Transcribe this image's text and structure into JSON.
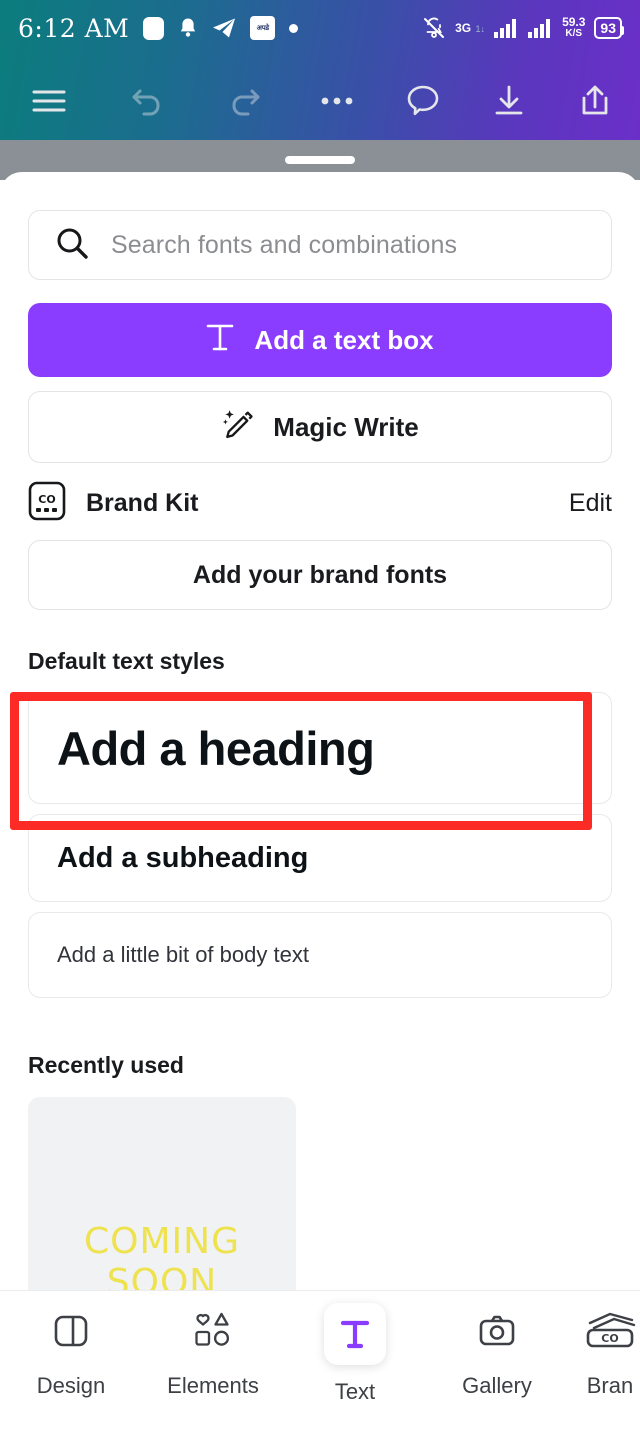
{
  "status_bar": {
    "time": "6:12 AM",
    "left_icons": [
      "rounded-square-icon",
      "bell-icon",
      "telegram-icon",
      "app-badge-icon",
      "dot-icon"
    ],
    "app_badge_text": "अपडे",
    "network_type": "3G",
    "network_sub": "1↓",
    "net_speed_value": "59.3",
    "net_speed_unit": "K/S",
    "battery_level": "93",
    "right_icons": [
      "bell-muted-icon",
      "signal-bars-icon",
      "signal-bars-2-icon",
      "battery-icon"
    ]
  },
  "toolbar": {
    "menu_icon": "hamburger-menu-icon",
    "undo_icon": "undo-icon",
    "redo_icon": "redo-icon",
    "more_icon": "more-dots-icon",
    "comment_icon": "comment-bubble-icon",
    "download_icon": "download-icon",
    "share_icon": "share-icon"
  },
  "panel": {
    "grabber": "drag-handle",
    "search": {
      "placeholder": "Search fonts and combinations",
      "value": "",
      "icon": "search-icon"
    },
    "add_text_box": {
      "label": "Add a text box",
      "icon": "text-t-icon",
      "color": "#8b3dff"
    },
    "magic_write": {
      "label": "Magic Write",
      "icon": "magic-pencil-icon"
    },
    "brand_kit": {
      "label": "Brand Kit",
      "edit_label": "Edit",
      "icon": "brand-kit-icon"
    },
    "add_brand_fonts": {
      "label": "Add your brand fonts"
    },
    "default_text_styles": {
      "title": "Default text styles",
      "items": [
        {
          "label": "Add a heading",
          "style": "heading"
        },
        {
          "label": "Add a subheading",
          "style": "subheading"
        },
        {
          "label": "Add a little bit of body text",
          "style": "body"
        }
      ]
    },
    "recently_used": {
      "title": "Recently used",
      "items": [
        {
          "line1": "COMING",
          "line2": "SOON",
          "text_color": "#eee24f"
        }
      ]
    }
  },
  "highlight": {
    "target": "Add a heading",
    "color": "#fc2b25"
  },
  "bottom_nav": {
    "items": [
      {
        "label": "Design",
        "icon": "design-layout-icon",
        "active": false
      },
      {
        "label": "Elements",
        "icon": "shapes-icon",
        "active": false
      },
      {
        "label": "Text",
        "icon": "text-t-icon",
        "active": true
      },
      {
        "label": "Gallery",
        "icon": "camera-icon",
        "active": false
      },
      {
        "label": "Bran",
        "icon": "brand-kit-icon",
        "active": false
      }
    ],
    "active_color": "#8b3dff"
  }
}
